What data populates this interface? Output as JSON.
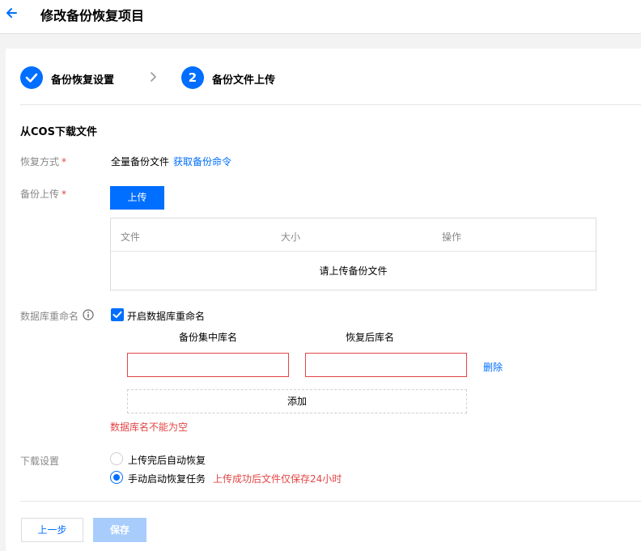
{
  "header": {
    "title": "修改备份恢复项目"
  },
  "steps": [
    {
      "label": "备份恢复设置",
      "state": "done"
    },
    {
      "number": "2",
      "label": "备份文件上传",
      "state": "current"
    }
  ],
  "section": {
    "title": "从COS下载文件"
  },
  "restore_mode": {
    "label": "恢复方式",
    "required_mark": "*",
    "value": "全量备份文件",
    "link": "获取备份命令"
  },
  "backup_upload": {
    "label": "备份上传",
    "required_mark": "*",
    "button": "上传",
    "table": {
      "columns": [
        "文件",
        "大小",
        "操作"
      ],
      "empty_message": "请上传备份文件"
    }
  },
  "db_rename": {
    "label": "数据库重命名",
    "checkbox_label": "开启数据库重命名",
    "checked": true,
    "col_source": "备份集中库名",
    "col_target": "恢复后库名",
    "source_value": "",
    "target_value": "",
    "delete_link": "删除",
    "add_button": "添加",
    "error": "数据库名不能为空"
  },
  "download": {
    "label": "下载设置",
    "options": [
      {
        "label": "上传完后自动恢复",
        "selected": false
      },
      {
        "label": "手动启动恢复任务",
        "selected": true
      }
    ],
    "note": "上传成功后文件仅保存24小时"
  },
  "footer": {
    "prev": "上一步",
    "save": "保存"
  },
  "colors": {
    "accent": "#006eff",
    "error": "#e54545",
    "disabled": "#a8cdfd"
  },
  "icons": {
    "back": "back-arrow-icon",
    "check": "check-icon",
    "separator": "chevron-right-icon",
    "info": "info-icon"
  }
}
